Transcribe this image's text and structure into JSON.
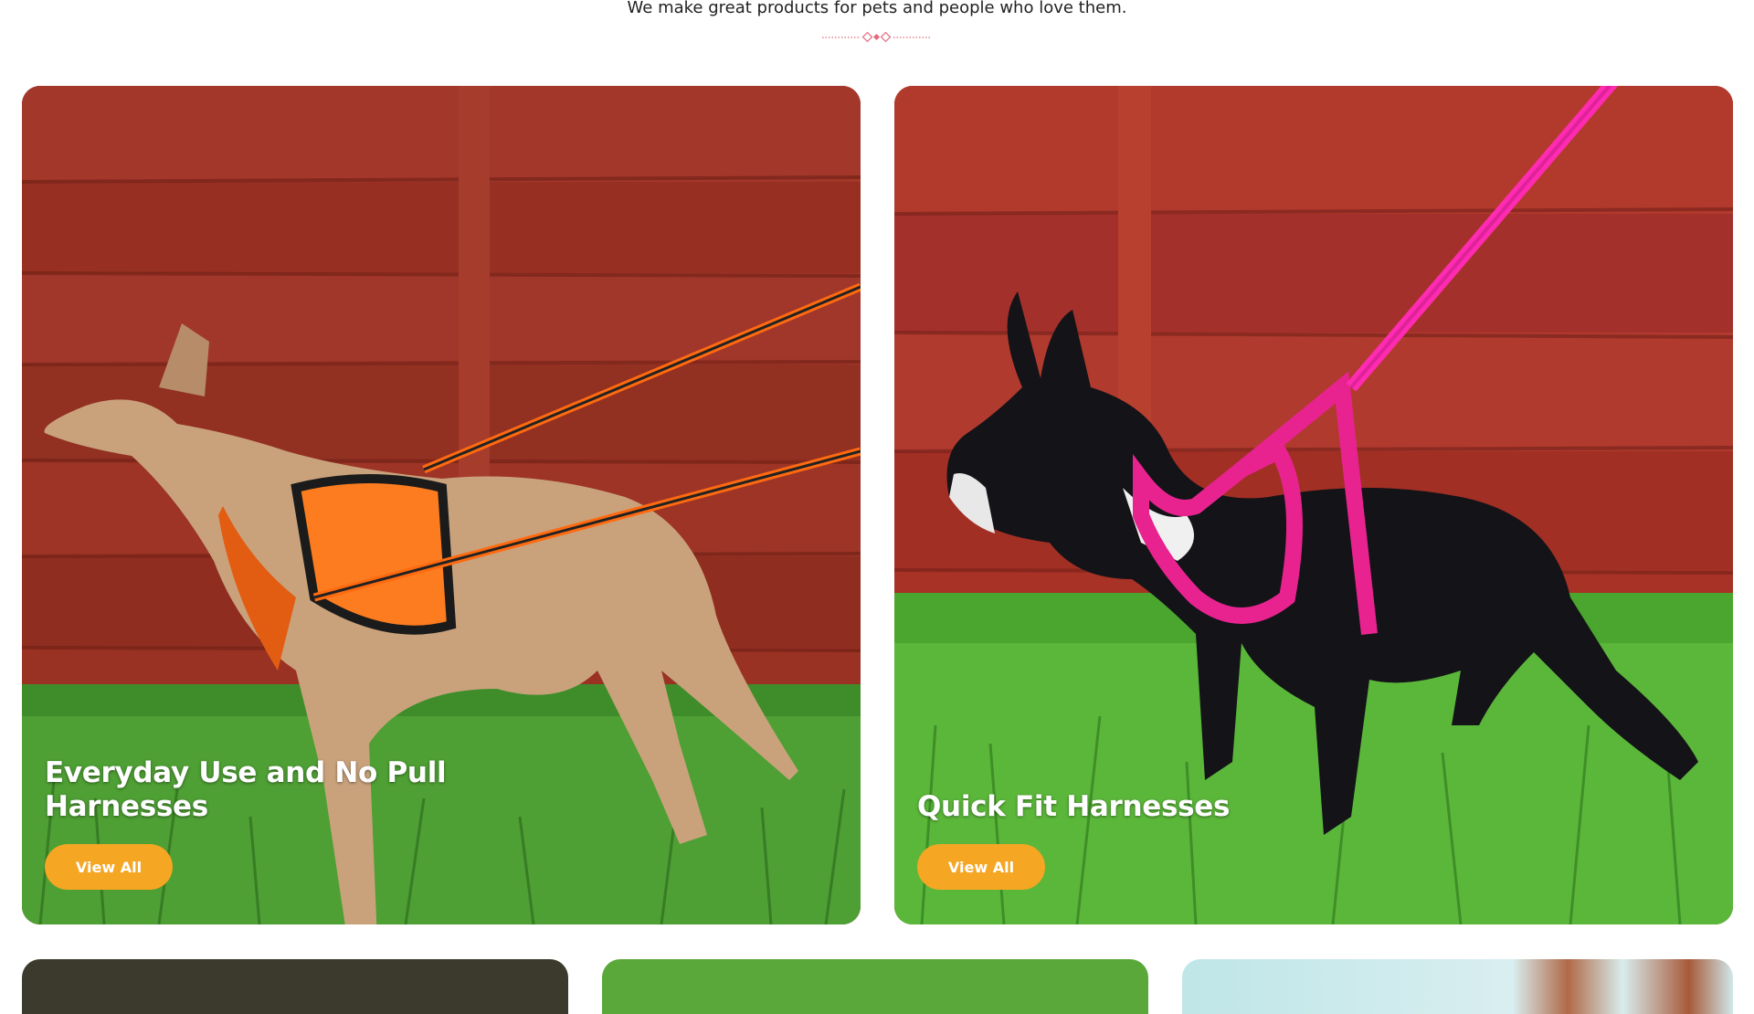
{
  "intro": {
    "tagline": "We make great products for pets and people who love them."
  },
  "colors": {
    "accent": "#f5a623",
    "divider": "#e26a7e"
  },
  "cards": [
    {
      "title_line1": "Everyday Use and No Pull",
      "title_line2": "Harnesses",
      "button_label": "View All",
      "image": "whippet-orange-harness"
    },
    {
      "title_line1": "Quick Fit Harnesses",
      "button_label": "View All",
      "image": "french-bulldog-pink-harness"
    }
  ]
}
